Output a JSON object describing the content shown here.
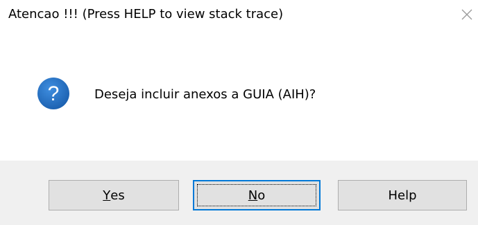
{
  "window": {
    "title": "Atencao !!!  (Press HELP to view stack trace)",
    "close_icon": "close-icon"
  },
  "message": {
    "icon": "question-icon",
    "icon_glyph": "?",
    "text": "Deseja incluir anexos a GUIA (AIH)?"
  },
  "buttons": {
    "yes": {
      "mnemonic": "Y",
      "rest": "es"
    },
    "no": {
      "mnemonic": "N",
      "rest": "o"
    },
    "help": {
      "label": "Help"
    }
  },
  "colors": {
    "icon_blue": "#1a66b5",
    "focus_border": "#0078d7",
    "footer_bg": "#f0f0f0",
    "button_bg": "#e1e1e1"
  }
}
